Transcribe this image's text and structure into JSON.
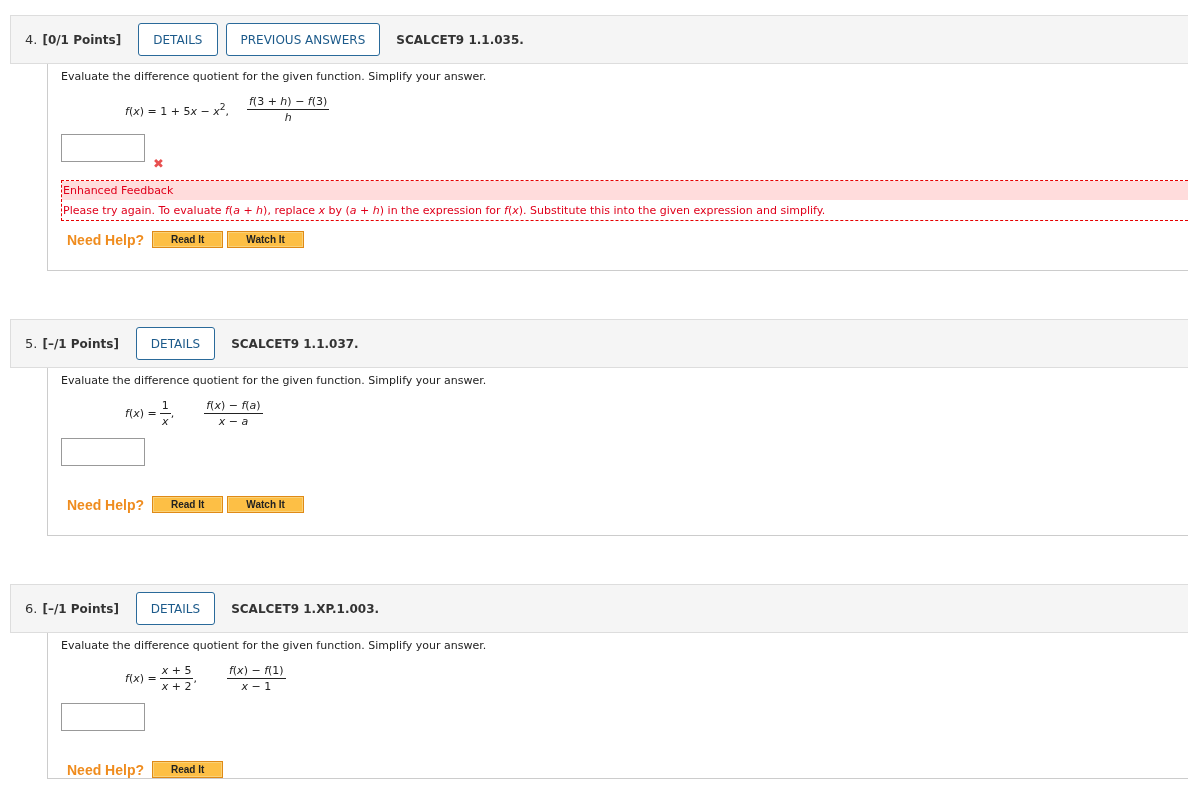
{
  "questions": [
    {
      "number": "4.",
      "points": "[0/1 Points]",
      "buttons": [
        "DETAILS",
        "PREVIOUS ANSWERS"
      ],
      "code": "SCALCET9 1.1.035.",
      "prompt": "Evaluate the difference quotient for the given function. Simplify your answer.",
      "function": {
        "kind": "inline",
        "parts": [
          "*f*(*x*) = 1 + 5",
          "*x* − *x*$^{2}$,"
        ]
      },
      "quotient": {
        "numerator": "*f*(3 + *h*) − *f*(3)",
        "denominator": "*h*"
      },
      "answer": {
        "mark": "✖"
      },
      "feedback": {
        "title": "Enhanced Feedback",
        "text": "Please try again. To evaluate *f*(*a* + *h*), replace *x* by (*a* + *h*) in the expression for *f*(*x*). Substitute this into the given expression and simplify."
      },
      "help_label": "Need Help?",
      "help_buttons": [
        "Read It",
        "Watch It"
      ]
    },
    {
      "number": "5.",
      "points": "[–/1 Points]",
      "buttons": [
        "DETAILS"
      ],
      "code": "SCALCET9 1.1.037.",
      "prompt": "Evaluate the difference quotient for the given function. Simplify your answer.",
      "function": {
        "kind": "fraction",
        "lhs": "*f*(*x*) =",
        "numerator": "1",
        "denominator": "*x*",
        "suffix": ","
      },
      "quotient": {
        "numerator": "*f*(*x*) − *f*(*a*)",
        "denominator": "*x* − *a*"
      },
      "help_label": "Need Help?",
      "help_buttons": [
        "Read It",
        "Watch It"
      ]
    },
    {
      "number": "6.",
      "points": "[–/1 Points]",
      "buttons": [
        "DETAILS"
      ],
      "code": "SCALCET9 1.XP.1.003.",
      "prompt": "Evaluate the difference quotient for the given function. Simplify your answer.",
      "function": {
        "kind": "fraction",
        "lhs": "*f*(*x*) =",
        "numerator": "*x* + 5",
        "denominator": "*x* + 2",
        "suffix": ","
      },
      "quotient": {
        "numerator": "*f*(*x*) − *f*(1)",
        "denominator": "*x* − 1"
      },
      "help_label": "Need Help?",
      "help_buttons": [
        "Read It"
      ]
    }
  ]
}
